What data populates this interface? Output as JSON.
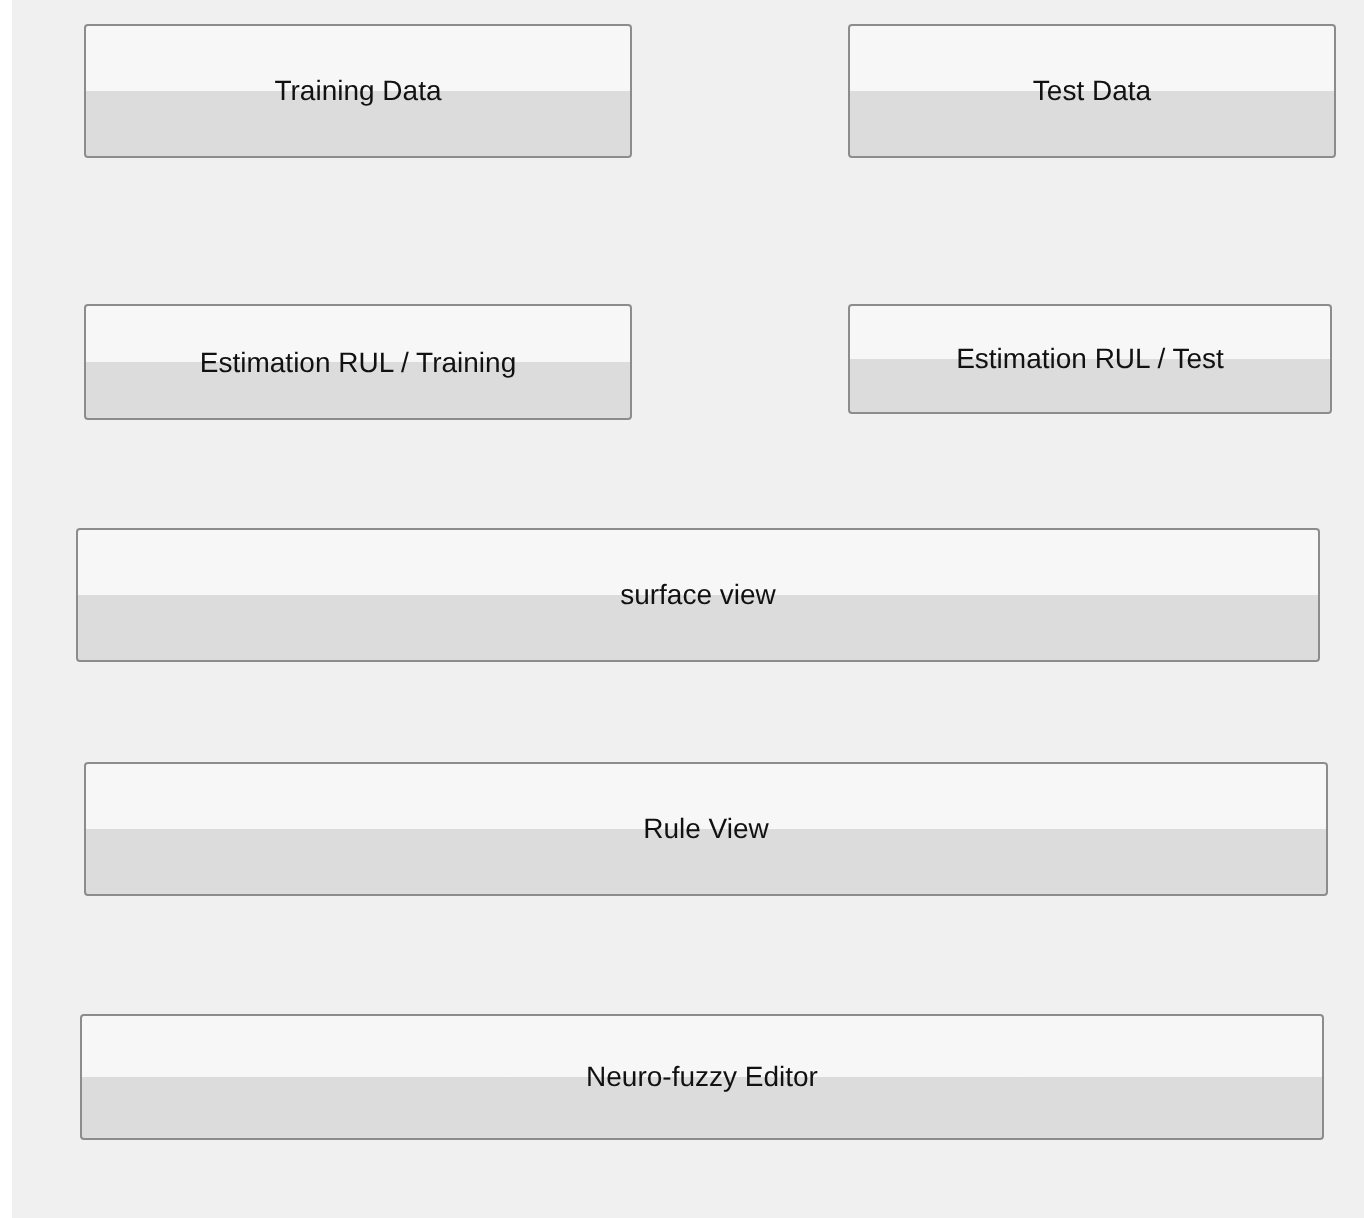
{
  "rows": [
    {
      "buttons": [
        {
          "label": "Training Data"
        },
        {
          "label": "Test Data"
        }
      ]
    },
    {
      "buttons": [
        {
          "label": "Estimation RUL / Training"
        },
        {
          "label": "Estimation RUL / Test"
        }
      ]
    },
    {
      "buttons": [
        {
          "label": "surface view"
        }
      ]
    },
    {
      "buttons": [
        {
          "label": "Rule View"
        }
      ]
    },
    {
      "buttons": [
        {
          "label": "Neuro-fuzzy Editor"
        }
      ]
    }
  ]
}
